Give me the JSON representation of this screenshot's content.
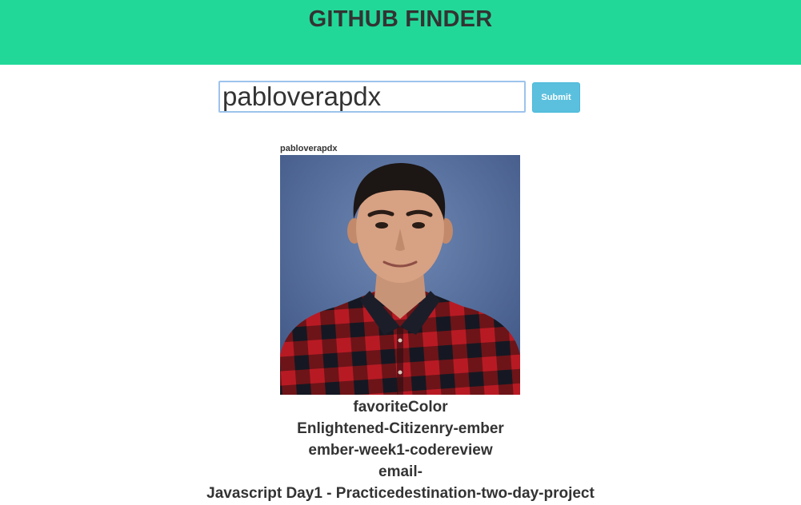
{
  "header": {
    "title": "GITHUB FINDER"
  },
  "search": {
    "value": "pabloverapdx",
    "submit_label": "Submit"
  },
  "profile": {
    "username": "pabloverapdx",
    "avatar_description": "profile-photo"
  },
  "repos": [
    "favoriteColor",
    "Enlightened-Citizenry-ember",
    "ember-week1-codereview",
    "email-",
    "Javascript Day1 - Practicedestination-two-day-project"
  ],
  "colors": {
    "header_bg": "#22d899",
    "button_bg": "#5bc0de",
    "input_border": "#9dc3ec",
    "text": "#333333"
  }
}
